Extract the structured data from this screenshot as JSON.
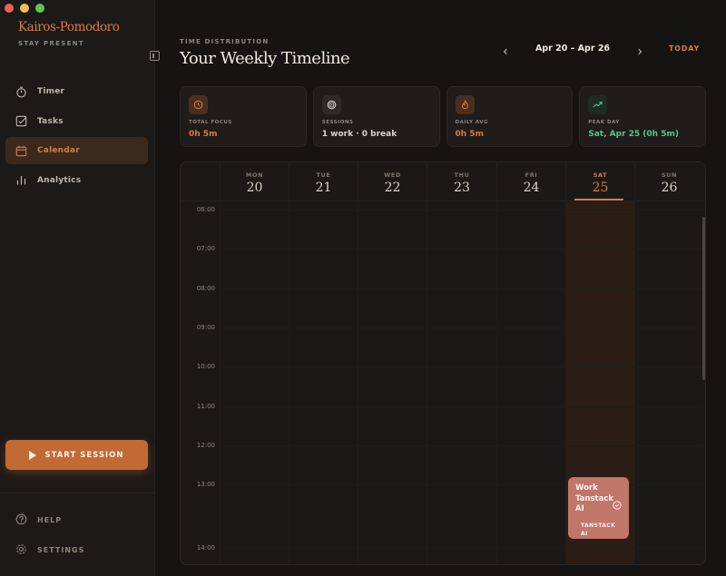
{
  "window": {
    "controls": [
      "close",
      "minimize",
      "zoom"
    ]
  },
  "sidebar": {
    "brand": "Kairos-Pomodoro",
    "tagline": "STAY PRESENT",
    "nav": [
      {
        "label": "Timer",
        "icon": "stopwatch-icon",
        "active": false
      },
      {
        "label": "Tasks",
        "icon": "checkbox-icon",
        "active": false
      },
      {
        "label": "Calendar",
        "icon": "calendar-icon",
        "active": true
      },
      {
        "label": "Analytics",
        "icon": "bar-chart-icon",
        "active": false
      }
    ],
    "start_label": "START SESSION",
    "help_label": "HELP",
    "settings_label": "SETTINGS"
  },
  "header": {
    "eyebrow": "TIME DISTRIBUTION",
    "title": "Your Weekly Timeline",
    "range": "Apr 20 – Apr 26",
    "today_label": "TODAY"
  },
  "stats": [
    {
      "label": "TOTAL FOCUS",
      "value": "0h 5m",
      "icon": "clock-icon",
      "color": "#d87a45",
      "icon_bg": "#4a2f1e"
    },
    {
      "label": "SESSIONS",
      "value": "1 work · 0 break",
      "icon": "target-icon",
      "color": "#d8d2ca",
      "icon_bg": "#2d2a27"
    },
    {
      "label": "DAILY AVG",
      "value": "0h 5m",
      "icon": "flame-icon",
      "color": "#d87a45",
      "icon_bg": "#4a2f1e"
    },
    {
      "label": "PEAK DAY",
      "value": "Sat, Apr 25 (0h 5m)",
      "icon": "trend-up-icon",
      "color": "#57c48a",
      "icon_bg": "#1f2c24"
    }
  ],
  "calendar": {
    "days": [
      {
        "name": "MON",
        "date": "20"
      },
      {
        "name": "TUE",
        "date": "21"
      },
      {
        "name": "WED",
        "date": "22"
      },
      {
        "name": "THU",
        "date": "23"
      },
      {
        "name": "FRI",
        "date": "24"
      },
      {
        "name": "SAT",
        "date": "25",
        "today": true
      },
      {
        "name": "SUN",
        "date": "26"
      }
    ],
    "hours": [
      "06:00",
      "07:00",
      "08:00",
      "09:00",
      "10:00",
      "11:00",
      "12:00",
      "13:00",
      "14:00"
    ],
    "event": {
      "title": "Work Tanstack AI",
      "tag": "TANSTACK AI",
      "color": "#c1766a"
    }
  },
  "colors": {
    "accent": "#d87a45",
    "success": "#57c48a"
  }
}
